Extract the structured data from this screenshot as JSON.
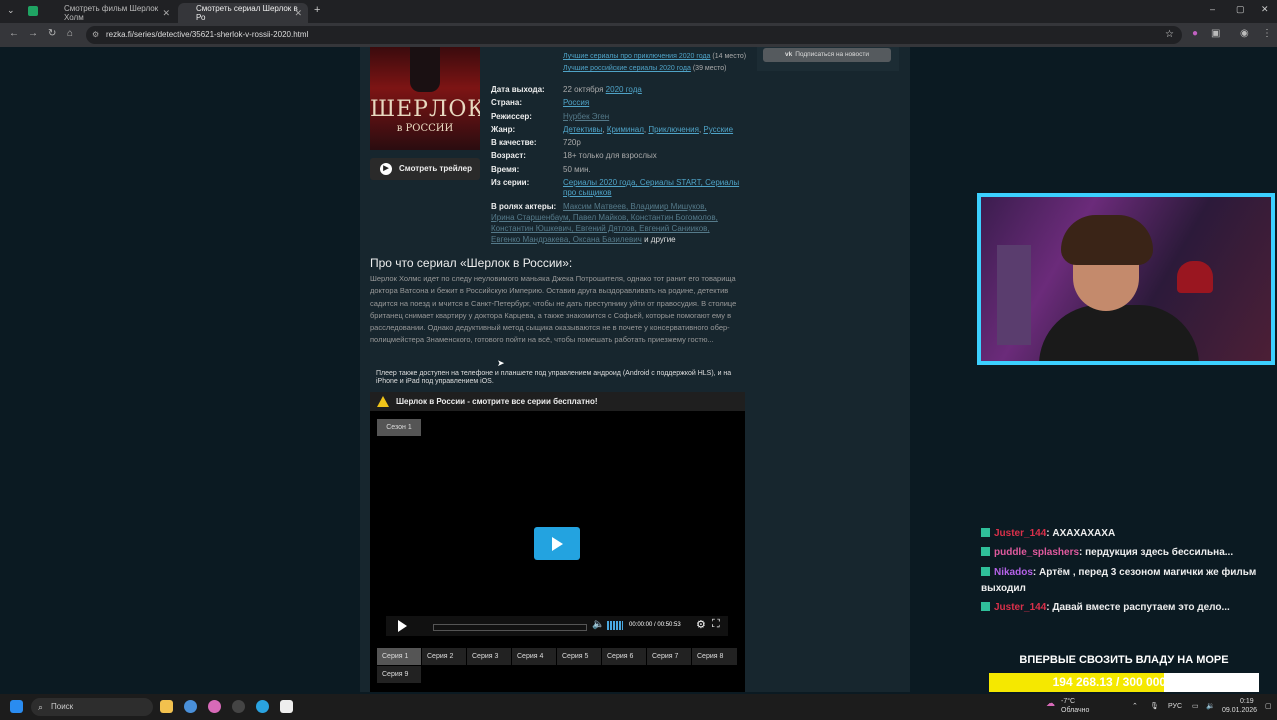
{
  "browser": {
    "tabs": [
      {
        "title": "Смотреть фильм Шерлок Холм",
        "active": false
      },
      {
        "title": "Смотреть сериал Шерлок в Ро",
        "active": true
      }
    ],
    "url": "rezka.fi/series/detective/35621-sherlok-v-rossii-2020.html"
  },
  "page": {
    "top_links": [
      {
        "text": "Лучшие сериалы про приключения 2020 года",
        "rank": "(14 место)"
      },
      {
        "text": "Лучшие российские сериалы 2020 года",
        "rank": "(39 место)"
      }
    ],
    "vk_button": "Подписаться на новости",
    "poster": {
      "title": "ШЕРЛОК",
      "subtitle": "в РОССИИ"
    },
    "trailer_button": "Смотреть трейлер",
    "info": {
      "release_label": "Дата выхода:",
      "release_day": "22 октября",
      "release_year": "2020 года",
      "country_label": "Страна:",
      "country": "Россия",
      "director_label": "Режиссер:",
      "director": "Нурбек Эген",
      "genre_label": "Жанр:",
      "genres": [
        "Детективы",
        "Криминал",
        "Приключения",
        "Русские"
      ],
      "quality_label": "В качестве:",
      "quality": "720p",
      "age_label": "Возраст:",
      "age": "18+ только для взрослых",
      "time_label": "Время:",
      "time": "50 мин.",
      "series_label": "Из серии:",
      "series_line1": "Сериалы 2020 года, Сериалы START, Сериалы",
      "series_line2": "про сыщиков",
      "cast_label": "В ролях актеры:",
      "cast_line1": "Максим Матвеев, Владимир Мишуков,",
      "cast_line2": "Ирина Старшенбаум, Павел Майков, Константин Богомолов,",
      "cast_line3": "Константин Юшкевич, Евгений Дятлов, Евгений Сании­ков,",
      "cast_line4": "Евгенко Мандракева, Оксана Базилевич",
      "cast_more": "и другие"
    },
    "about_title": "Про что сериал «Шерлок в России»:",
    "description": "Шерлок Холмс идет по следу неуловимого маньяка Джека Потрошителя, однако тот ранит его товарища доктора Ватсона и бежит в Российскую Империю. Оставив друга выздоравливать на родине, детектив садится на поезд и мчится в Санкт-Петербург, чтобы не дать преступнику уйти от правосудия. В столице британец снимает квартиру у доктора Карцева, а также знакомится с Софьей, которые помогают ему в расследовании. Однако дедуктивный метод сыщика оказываются не в почете у консервативного обер-полицмейстера Знаменского, готового пойти на всё, чтобы помешать работать приезжему гостю...",
    "player_note": "Плеер также доступен на телефоне и планшете под управлением андроид (Android с поддержкой HLS), и на iPhone и iPad под управлением iOS.",
    "warning": "Шерлок в России - смотрите все серии бесплатно!",
    "season": "Сезон 1",
    "player_time": "00:00:00 / 00:50:53",
    "episodes": [
      "Серия 1",
      "Серия 2",
      "Серия 3",
      "Серия 4",
      "Серия 5",
      "Серия 6",
      "Серия 7",
      "Серия 8",
      "Серия 9"
    ]
  },
  "chat": [
    {
      "user": "Juster_144",
      "message": ": АХАХАХАХА",
      "color": "#d9304a"
    },
    {
      "user": "puddle_splashers",
      "message": ": пердукция здесь бессильна...",
      "color": "#e05a9e"
    },
    {
      "user": "Nikados",
      "message": ": Артём , перед 3 сезоном магички же фильм выходил",
      "color": "#b562e8"
    },
    {
      "user": "Juster_144",
      "message": ": Давай вместе распутаем это дело...",
      "color": "#d9304a"
    }
  ],
  "donation": {
    "title": "ВПЕРВЫЕ СВОЗИТЬ ВЛАДУ НА МОРЕ",
    "progress_text": "194 268.13 / 300 000 RUB",
    "fraction": 0.6476
  },
  "taskbar": {
    "search": "Поиск",
    "weather_temp": "-7°C",
    "weather_desc": "Облачно",
    "lang": "РУС",
    "clock_time": "0:19",
    "clock_date": "09.01.2026"
  }
}
